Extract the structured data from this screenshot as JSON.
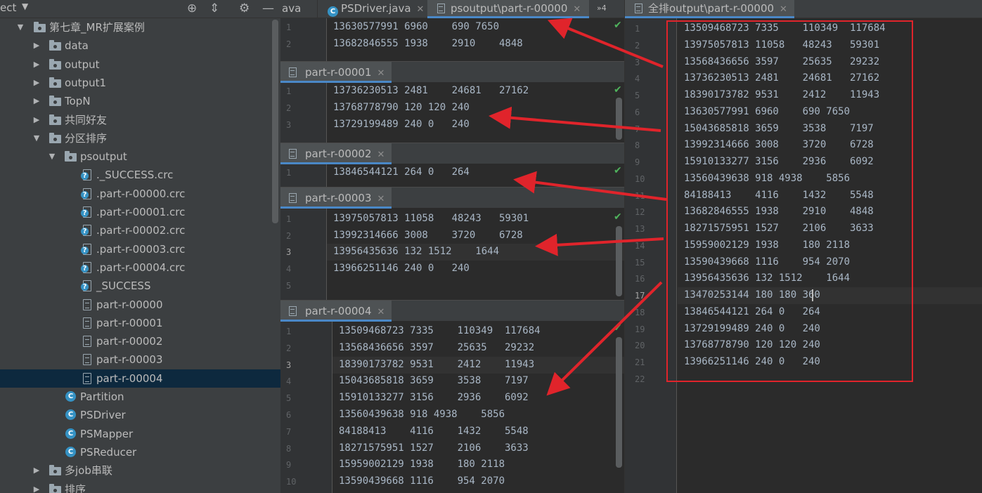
{
  "project": {
    "title": "ect",
    "dropdown": "▼",
    "toolbar_icons": [
      "crosshair-icon",
      "collapse-icon",
      "gear-icon",
      "minimize-icon"
    ],
    "tree": [
      {
        "label": "第七章_MR扩展案例",
        "type": "folder",
        "depth": 0,
        "expanded": true
      },
      {
        "label": "data",
        "type": "folder",
        "depth": 1,
        "expanded": false
      },
      {
        "label": "output",
        "type": "folder",
        "depth": 1,
        "expanded": false
      },
      {
        "label": "output1",
        "type": "folder",
        "depth": 1,
        "expanded": false
      },
      {
        "label": "TopN",
        "type": "folder",
        "depth": 1,
        "expanded": false
      },
      {
        "label": "共同好友",
        "type": "folder",
        "depth": 1,
        "expanded": false
      },
      {
        "label": "分区排序",
        "type": "folder",
        "depth": 1,
        "expanded": true
      },
      {
        "label": "psoutput",
        "type": "folder",
        "depth": 2,
        "expanded": true
      },
      {
        "label": "._SUCCESS.crc",
        "type": "qfile",
        "depth": 3
      },
      {
        "label": ".part-r-00000.crc",
        "type": "qfile",
        "depth": 3
      },
      {
        "label": ".part-r-00001.crc",
        "type": "qfile",
        "depth": 3
      },
      {
        "label": ".part-r-00002.crc",
        "type": "qfile",
        "depth": 3
      },
      {
        "label": ".part-r-00003.crc",
        "type": "qfile",
        "depth": 3
      },
      {
        "label": ".part-r-00004.crc",
        "type": "qfile",
        "depth": 3
      },
      {
        "label": "_SUCCESS",
        "type": "qfile",
        "depth": 3
      },
      {
        "label": "part-r-00000",
        "type": "file",
        "depth": 3
      },
      {
        "label": "part-r-00001",
        "type": "file",
        "depth": 3
      },
      {
        "label": "part-r-00002",
        "type": "file",
        "depth": 3
      },
      {
        "label": "part-r-00003",
        "type": "file",
        "depth": 3
      },
      {
        "label": "part-r-00004",
        "type": "file",
        "depth": 3,
        "selected": true
      },
      {
        "label": "Partition",
        "type": "class",
        "depth": 2
      },
      {
        "label": "PSDriver",
        "type": "class",
        "depth": 2
      },
      {
        "label": "PSMapper",
        "type": "class",
        "depth": 2
      },
      {
        "label": "PSReducer",
        "type": "class",
        "depth": 2
      },
      {
        "label": "多job串联",
        "type": "folder",
        "depth": 1,
        "expanded": false
      },
      {
        "label": "排序",
        "type": "folder",
        "depth": 1,
        "expanded": false
      }
    ]
  },
  "left_editor": {
    "tabs": {
      "java_partial": "ava",
      "psdriver": "PSDriver.java",
      "psoutput": "psoutput\\part-r-00000",
      "overflow": "»4"
    },
    "panes": [
      {
        "header": "",
        "lines": [
          "13630577991 6960    690 7650",
          "13682846555 1938    2910    4848"
        ],
        "numbers": [
          "1",
          "2"
        ]
      },
      {
        "header": "part-r-00001",
        "lines": [
          "13736230513 2481    24681   27162",
          "13768778790 120 120 240",
          "13729199489 240 0   240"
        ],
        "numbers": [
          "1",
          "2",
          "3"
        ]
      },
      {
        "header": "part-r-00002",
        "lines": [
          "13846544121 264 0   264"
        ],
        "numbers": [
          "1"
        ]
      },
      {
        "header": "part-r-00003",
        "lines": [
          "13975057813 11058   48243   59301",
          "13992314666 3008    3720    6728",
          "13956435636 132 1512    1644",
          "13966251146 240 0   240",
          ""
        ],
        "numbers": [
          "1",
          "2",
          "3",
          "4",
          "5"
        ]
      },
      {
        "header": "part-r-00004",
        "lines": [
          "13509468723 7335    110349  117684",
          "13568436656 3597    25635   29232",
          "18390173782 9531    2412    11943",
          "15043685818 3659    3538    7197",
          "15910133277 3156    2936    6092",
          "13560439638 918 4938    5856",
          "84188413    4116    1432    5548",
          "18271575951 1527    2106    3633",
          "15959002129 1938    180 2118",
          "13590439668 1116    954 2070"
        ],
        "numbers": [
          "1",
          "2",
          "3",
          "4",
          "5",
          "6",
          "7",
          "8",
          "9",
          "10"
        ]
      }
    ]
  },
  "right_editor": {
    "tab": "全排output\\part-r-00000",
    "lines": [
      "13509468723 7335    110349  117684",
      "13975057813 11058   48243   59301",
      "13568436656 3597    25635   29232",
      "13736230513 2481    24681   27162",
      "18390173782 9531    2412    11943",
      "13630577991 6960    690 7650",
      "15043685818 3659    3538    7197",
      "13992314666 3008    3720    6728",
      "15910133277 3156    2936    6092",
      "13560439638 918 4938    5856",
      "84188413    4116    1432    5548",
      "13682846555 1938    2910    4848",
      "18271575951 1527    2106    3633",
      "15959002129 1938    180 2118",
      "13590439668 1116    954 2070",
      "13956435636 132 1512    1644",
      "13470253144 180 180 360",
      "13846544121 264 0   264",
      "13729199489 240 0   240",
      "13768778790 120 120 240",
      "13966251146 240 0   240",
      ""
    ],
    "numbers": [
      "1",
      "2",
      "3",
      "4",
      "5",
      "6",
      "7",
      "8",
      "9",
      "10",
      "11",
      "12",
      "13",
      "14",
      "15",
      "16",
      "17",
      "18",
      "19",
      "20",
      "21",
      "22"
    ]
  },
  "colors": {
    "annotation_red": "#e0242b",
    "accent_blue": "#4a88c7",
    "check_green": "#4fb35c"
  }
}
